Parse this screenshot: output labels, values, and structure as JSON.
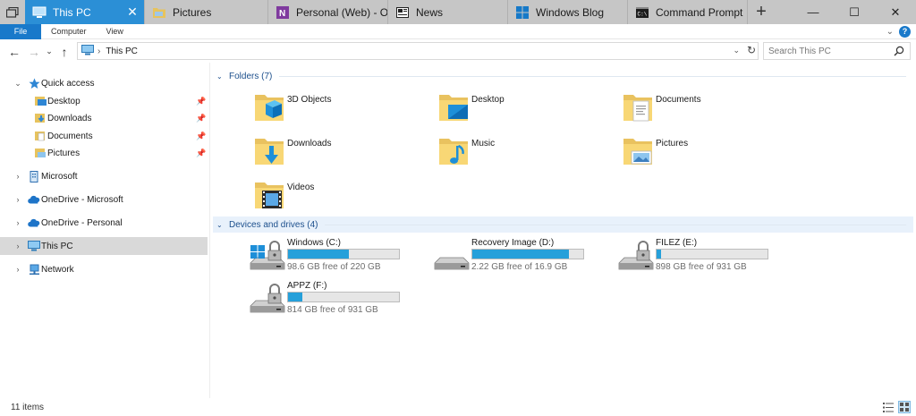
{
  "tabs": [
    {
      "label": "This PC",
      "icon": "pc-icon",
      "active": true
    },
    {
      "label": "Pictures",
      "icon": "folder-icon",
      "active": false
    },
    {
      "label": "Personal (Web) - One",
      "icon": "onenote-icon",
      "active": false
    },
    {
      "label": "News",
      "icon": "news-icon",
      "active": false
    },
    {
      "label": "Windows Blog",
      "icon": "edge-icon",
      "active": false
    },
    {
      "label": "Command Prompt",
      "icon": "cmd-icon",
      "active": false
    }
  ],
  "window": {
    "minimize": "—",
    "maximize": "☐",
    "close": "✕",
    "new_tab": "+"
  },
  "ribbon": {
    "file": "File",
    "computer": "Computer",
    "view": "View"
  },
  "address": {
    "path": "This PC",
    "separator": "›",
    "search_placeholder": "Search This PC"
  },
  "nav": {
    "quick_access": "Quick access",
    "quick_items": [
      {
        "label": "Desktop"
      },
      {
        "label": "Downloads"
      },
      {
        "label": "Documents"
      },
      {
        "label": "Pictures"
      }
    ],
    "microsoft": "Microsoft",
    "onedrive_ms": "OneDrive - Microsoft",
    "onedrive_personal": "OneDrive - Personal",
    "this_pc": "This PC",
    "network": "Network"
  },
  "folders_header": "Folders (7)",
  "folders": [
    {
      "label": "3D Objects",
      "icon": "3d-objects-folder-icon"
    },
    {
      "label": "Desktop",
      "icon": "desktop-folder-icon"
    },
    {
      "label": "Documents",
      "icon": "documents-folder-icon"
    },
    {
      "label": "Downloads",
      "icon": "downloads-folder-icon"
    },
    {
      "label": "Music",
      "icon": "music-folder-icon"
    },
    {
      "label": "Pictures",
      "icon": "pictures-folder-icon"
    },
    {
      "label": "Videos",
      "icon": "videos-folder-icon"
    }
  ],
  "drives_header": "Devices and drives (4)",
  "drives": [
    {
      "label": "Windows (C:)",
      "free": "98.6 GB free of 220 GB",
      "used_fraction": 0.55,
      "locked": true,
      "windows": true
    },
    {
      "label": "Recovery Image (D:)",
      "free": "2.22 GB free of 16.9 GB",
      "used_fraction": 0.87,
      "locked": false,
      "windows": false
    },
    {
      "label": "FILEZ (E:)",
      "free": "898 GB free of 931 GB",
      "used_fraction": 0.04,
      "locked": true,
      "windows": false
    },
    {
      "label": "APPZ (F:)",
      "free": "814 GB free of 931 GB",
      "used_fraction": 0.13,
      "locked": true,
      "windows": false
    }
  ],
  "status": {
    "count": "11 items"
  },
  "colors": {
    "accent": "#2b8fd6",
    "file_tab": "#1979ca",
    "bar_fill": "#26a0da",
    "folder_yellow": "#f8d775"
  }
}
